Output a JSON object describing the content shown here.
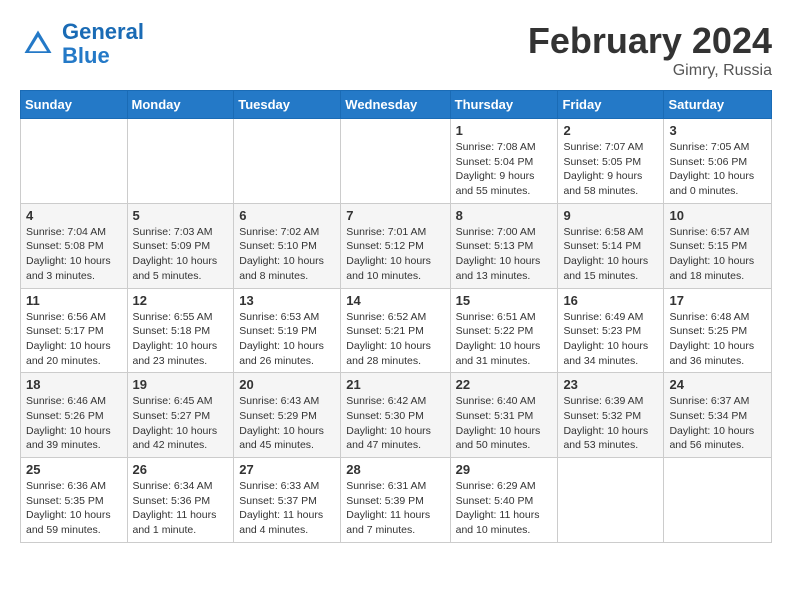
{
  "header": {
    "logo_general": "General",
    "logo_blue": "Blue",
    "month": "February 2024",
    "location": "Gimry, Russia"
  },
  "days_of_week": [
    "Sunday",
    "Monday",
    "Tuesday",
    "Wednesday",
    "Thursday",
    "Friday",
    "Saturday"
  ],
  "weeks": [
    [
      {
        "day": "",
        "info": ""
      },
      {
        "day": "",
        "info": ""
      },
      {
        "day": "",
        "info": ""
      },
      {
        "day": "",
        "info": ""
      },
      {
        "day": "1",
        "sunrise": "Sunrise: 7:08 AM",
        "sunset": "Sunset: 5:04 PM",
        "daylight": "Daylight: 9 hours and 55 minutes."
      },
      {
        "day": "2",
        "sunrise": "Sunrise: 7:07 AM",
        "sunset": "Sunset: 5:05 PM",
        "daylight": "Daylight: 9 hours and 58 minutes."
      },
      {
        "day": "3",
        "sunrise": "Sunrise: 7:05 AM",
        "sunset": "Sunset: 5:06 PM",
        "daylight": "Daylight: 10 hours and 0 minutes."
      }
    ],
    [
      {
        "day": "4",
        "sunrise": "Sunrise: 7:04 AM",
        "sunset": "Sunset: 5:08 PM",
        "daylight": "Daylight: 10 hours and 3 minutes."
      },
      {
        "day": "5",
        "sunrise": "Sunrise: 7:03 AM",
        "sunset": "Sunset: 5:09 PM",
        "daylight": "Daylight: 10 hours and 5 minutes."
      },
      {
        "day": "6",
        "sunrise": "Sunrise: 7:02 AM",
        "sunset": "Sunset: 5:10 PM",
        "daylight": "Daylight: 10 hours and 8 minutes."
      },
      {
        "day": "7",
        "sunrise": "Sunrise: 7:01 AM",
        "sunset": "Sunset: 5:12 PM",
        "daylight": "Daylight: 10 hours and 10 minutes."
      },
      {
        "day": "8",
        "sunrise": "Sunrise: 7:00 AM",
        "sunset": "Sunset: 5:13 PM",
        "daylight": "Daylight: 10 hours and 13 minutes."
      },
      {
        "day": "9",
        "sunrise": "Sunrise: 6:58 AM",
        "sunset": "Sunset: 5:14 PM",
        "daylight": "Daylight: 10 hours and 15 minutes."
      },
      {
        "day": "10",
        "sunrise": "Sunrise: 6:57 AM",
        "sunset": "Sunset: 5:15 PM",
        "daylight": "Daylight: 10 hours and 18 minutes."
      }
    ],
    [
      {
        "day": "11",
        "sunrise": "Sunrise: 6:56 AM",
        "sunset": "Sunset: 5:17 PM",
        "daylight": "Daylight: 10 hours and 20 minutes."
      },
      {
        "day": "12",
        "sunrise": "Sunrise: 6:55 AM",
        "sunset": "Sunset: 5:18 PM",
        "daylight": "Daylight: 10 hours and 23 minutes."
      },
      {
        "day": "13",
        "sunrise": "Sunrise: 6:53 AM",
        "sunset": "Sunset: 5:19 PM",
        "daylight": "Daylight: 10 hours and 26 minutes."
      },
      {
        "day": "14",
        "sunrise": "Sunrise: 6:52 AM",
        "sunset": "Sunset: 5:21 PM",
        "daylight": "Daylight: 10 hours and 28 minutes."
      },
      {
        "day": "15",
        "sunrise": "Sunrise: 6:51 AM",
        "sunset": "Sunset: 5:22 PM",
        "daylight": "Daylight: 10 hours and 31 minutes."
      },
      {
        "day": "16",
        "sunrise": "Sunrise: 6:49 AM",
        "sunset": "Sunset: 5:23 PM",
        "daylight": "Daylight: 10 hours and 34 minutes."
      },
      {
        "day": "17",
        "sunrise": "Sunrise: 6:48 AM",
        "sunset": "Sunset: 5:25 PM",
        "daylight": "Daylight: 10 hours and 36 minutes."
      }
    ],
    [
      {
        "day": "18",
        "sunrise": "Sunrise: 6:46 AM",
        "sunset": "Sunset: 5:26 PM",
        "daylight": "Daylight: 10 hours and 39 minutes."
      },
      {
        "day": "19",
        "sunrise": "Sunrise: 6:45 AM",
        "sunset": "Sunset: 5:27 PM",
        "daylight": "Daylight: 10 hours and 42 minutes."
      },
      {
        "day": "20",
        "sunrise": "Sunrise: 6:43 AM",
        "sunset": "Sunset: 5:29 PM",
        "daylight": "Daylight: 10 hours and 45 minutes."
      },
      {
        "day": "21",
        "sunrise": "Sunrise: 6:42 AM",
        "sunset": "Sunset: 5:30 PM",
        "daylight": "Daylight: 10 hours and 47 minutes."
      },
      {
        "day": "22",
        "sunrise": "Sunrise: 6:40 AM",
        "sunset": "Sunset: 5:31 PM",
        "daylight": "Daylight: 10 hours and 50 minutes."
      },
      {
        "day": "23",
        "sunrise": "Sunrise: 6:39 AM",
        "sunset": "Sunset: 5:32 PM",
        "daylight": "Daylight: 10 hours and 53 minutes."
      },
      {
        "day": "24",
        "sunrise": "Sunrise: 6:37 AM",
        "sunset": "Sunset: 5:34 PM",
        "daylight": "Daylight: 10 hours and 56 minutes."
      }
    ],
    [
      {
        "day": "25",
        "sunrise": "Sunrise: 6:36 AM",
        "sunset": "Sunset: 5:35 PM",
        "daylight": "Daylight: 10 hours and 59 minutes."
      },
      {
        "day": "26",
        "sunrise": "Sunrise: 6:34 AM",
        "sunset": "Sunset: 5:36 PM",
        "daylight": "Daylight: 11 hours and 1 minute."
      },
      {
        "day": "27",
        "sunrise": "Sunrise: 6:33 AM",
        "sunset": "Sunset: 5:37 PM",
        "daylight": "Daylight: 11 hours and 4 minutes."
      },
      {
        "day": "28",
        "sunrise": "Sunrise: 6:31 AM",
        "sunset": "Sunset: 5:39 PM",
        "daylight": "Daylight: 11 hours and 7 minutes."
      },
      {
        "day": "29",
        "sunrise": "Sunrise: 6:29 AM",
        "sunset": "Sunset: 5:40 PM",
        "daylight": "Daylight: 11 hours and 10 minutes."
      },
      {
        "day": "",
        "info": ""
      },
      {
        "day": "",
        "info": ""
      }
    ]
  ]
}
